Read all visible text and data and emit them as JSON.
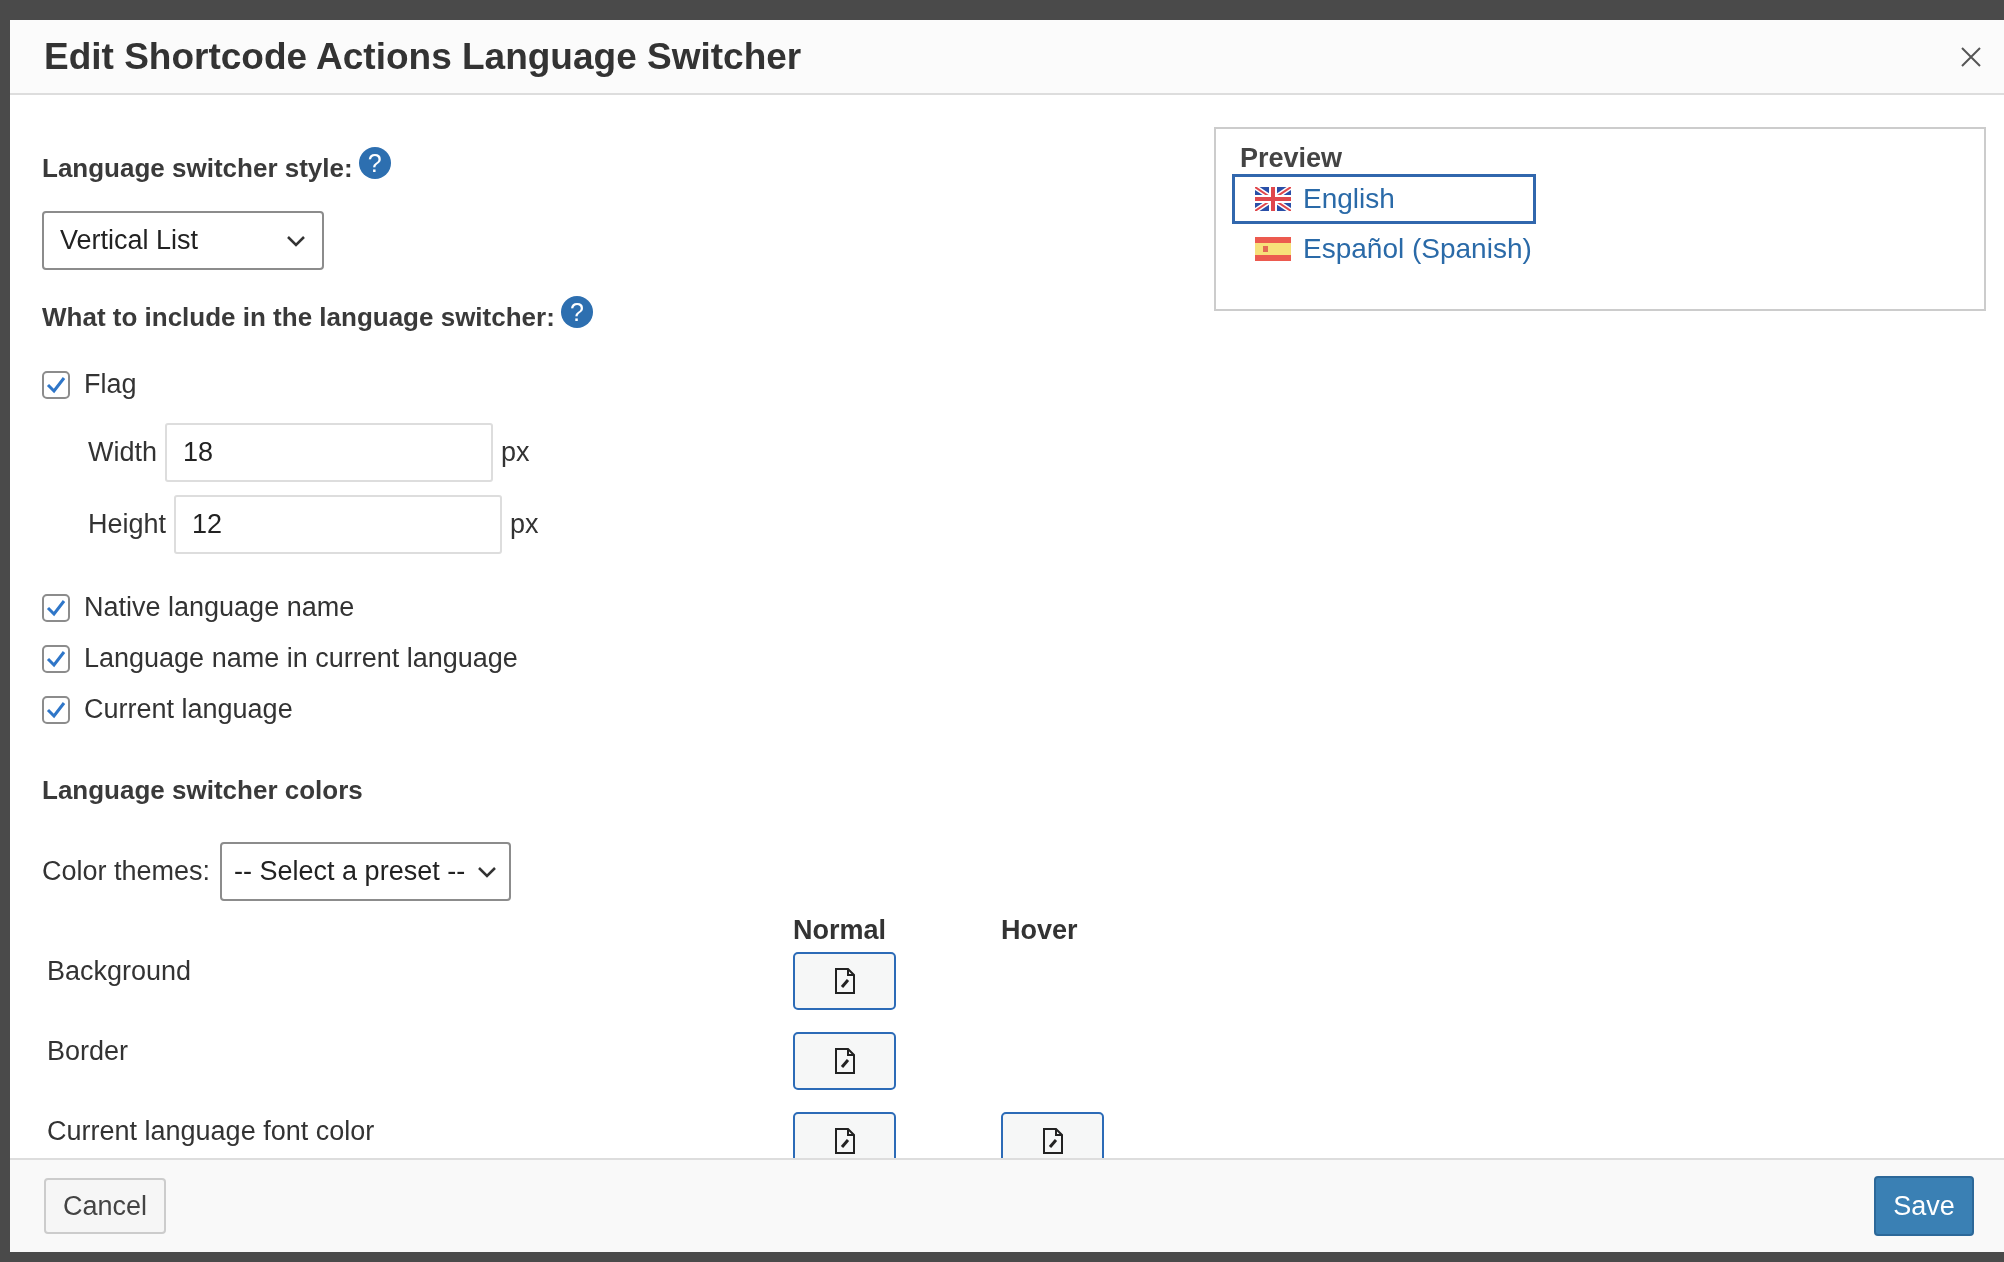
{
  "dialog": {
    "title": "Edit Shortcode Actions Language Switcher"
  },
  "style_section": {
    "label": "Language switcher style:",
    "help": "?",
    "select": "Vertical List"
  },
  "include": {
    "label": "What to include in the language switcher:",
    "help": "?",
    "flag": {
      "label": "Flag",
      "checked": true,
      "fields": [
        {
          "label": "Width",
          "value": "18",
          "unit": "px"
        },
        {
          "label": "Height",
          "value": "12",
          "unit": "px"
        }
      ]
    },
    "options": [
      {
        "label": "Native language name",
        "checked": true
      },
      {
        "label": "Language name in current language",
        "checked": true
      },
      {
        "label": "Current language",
        "checked": true
      }
    ]
  },
  "colors": {
    "title": "Language switcher colors",
    "theme_label": "Color themes:",
    "theme_select": "-- Select a preset --",
    "columns": [
      "Normal",
      "Hover"
    ],
    "rows": [
      {
        "label": "Background",
        "normal": true,
        "hover": false
      },
      {
        "label": "Border",
        "normal": true,
        "hover": false
      },
      {
        "label": "Current language font color",
        "normal": true,
        "hover": true
      }
    ]
  },
  "preview": {
    "title": "Preview",
    "languages": [
      {
        "name": "English",
        "kind": "uk",
        "selected": true
      },
      {
        "name": "Español (Spanish)",
        "kind": "es",
        "selected": false
      }
    ]
  },
  "footer": {
    "cancel": "Cancel",
    "save": "Save"
  }
}
